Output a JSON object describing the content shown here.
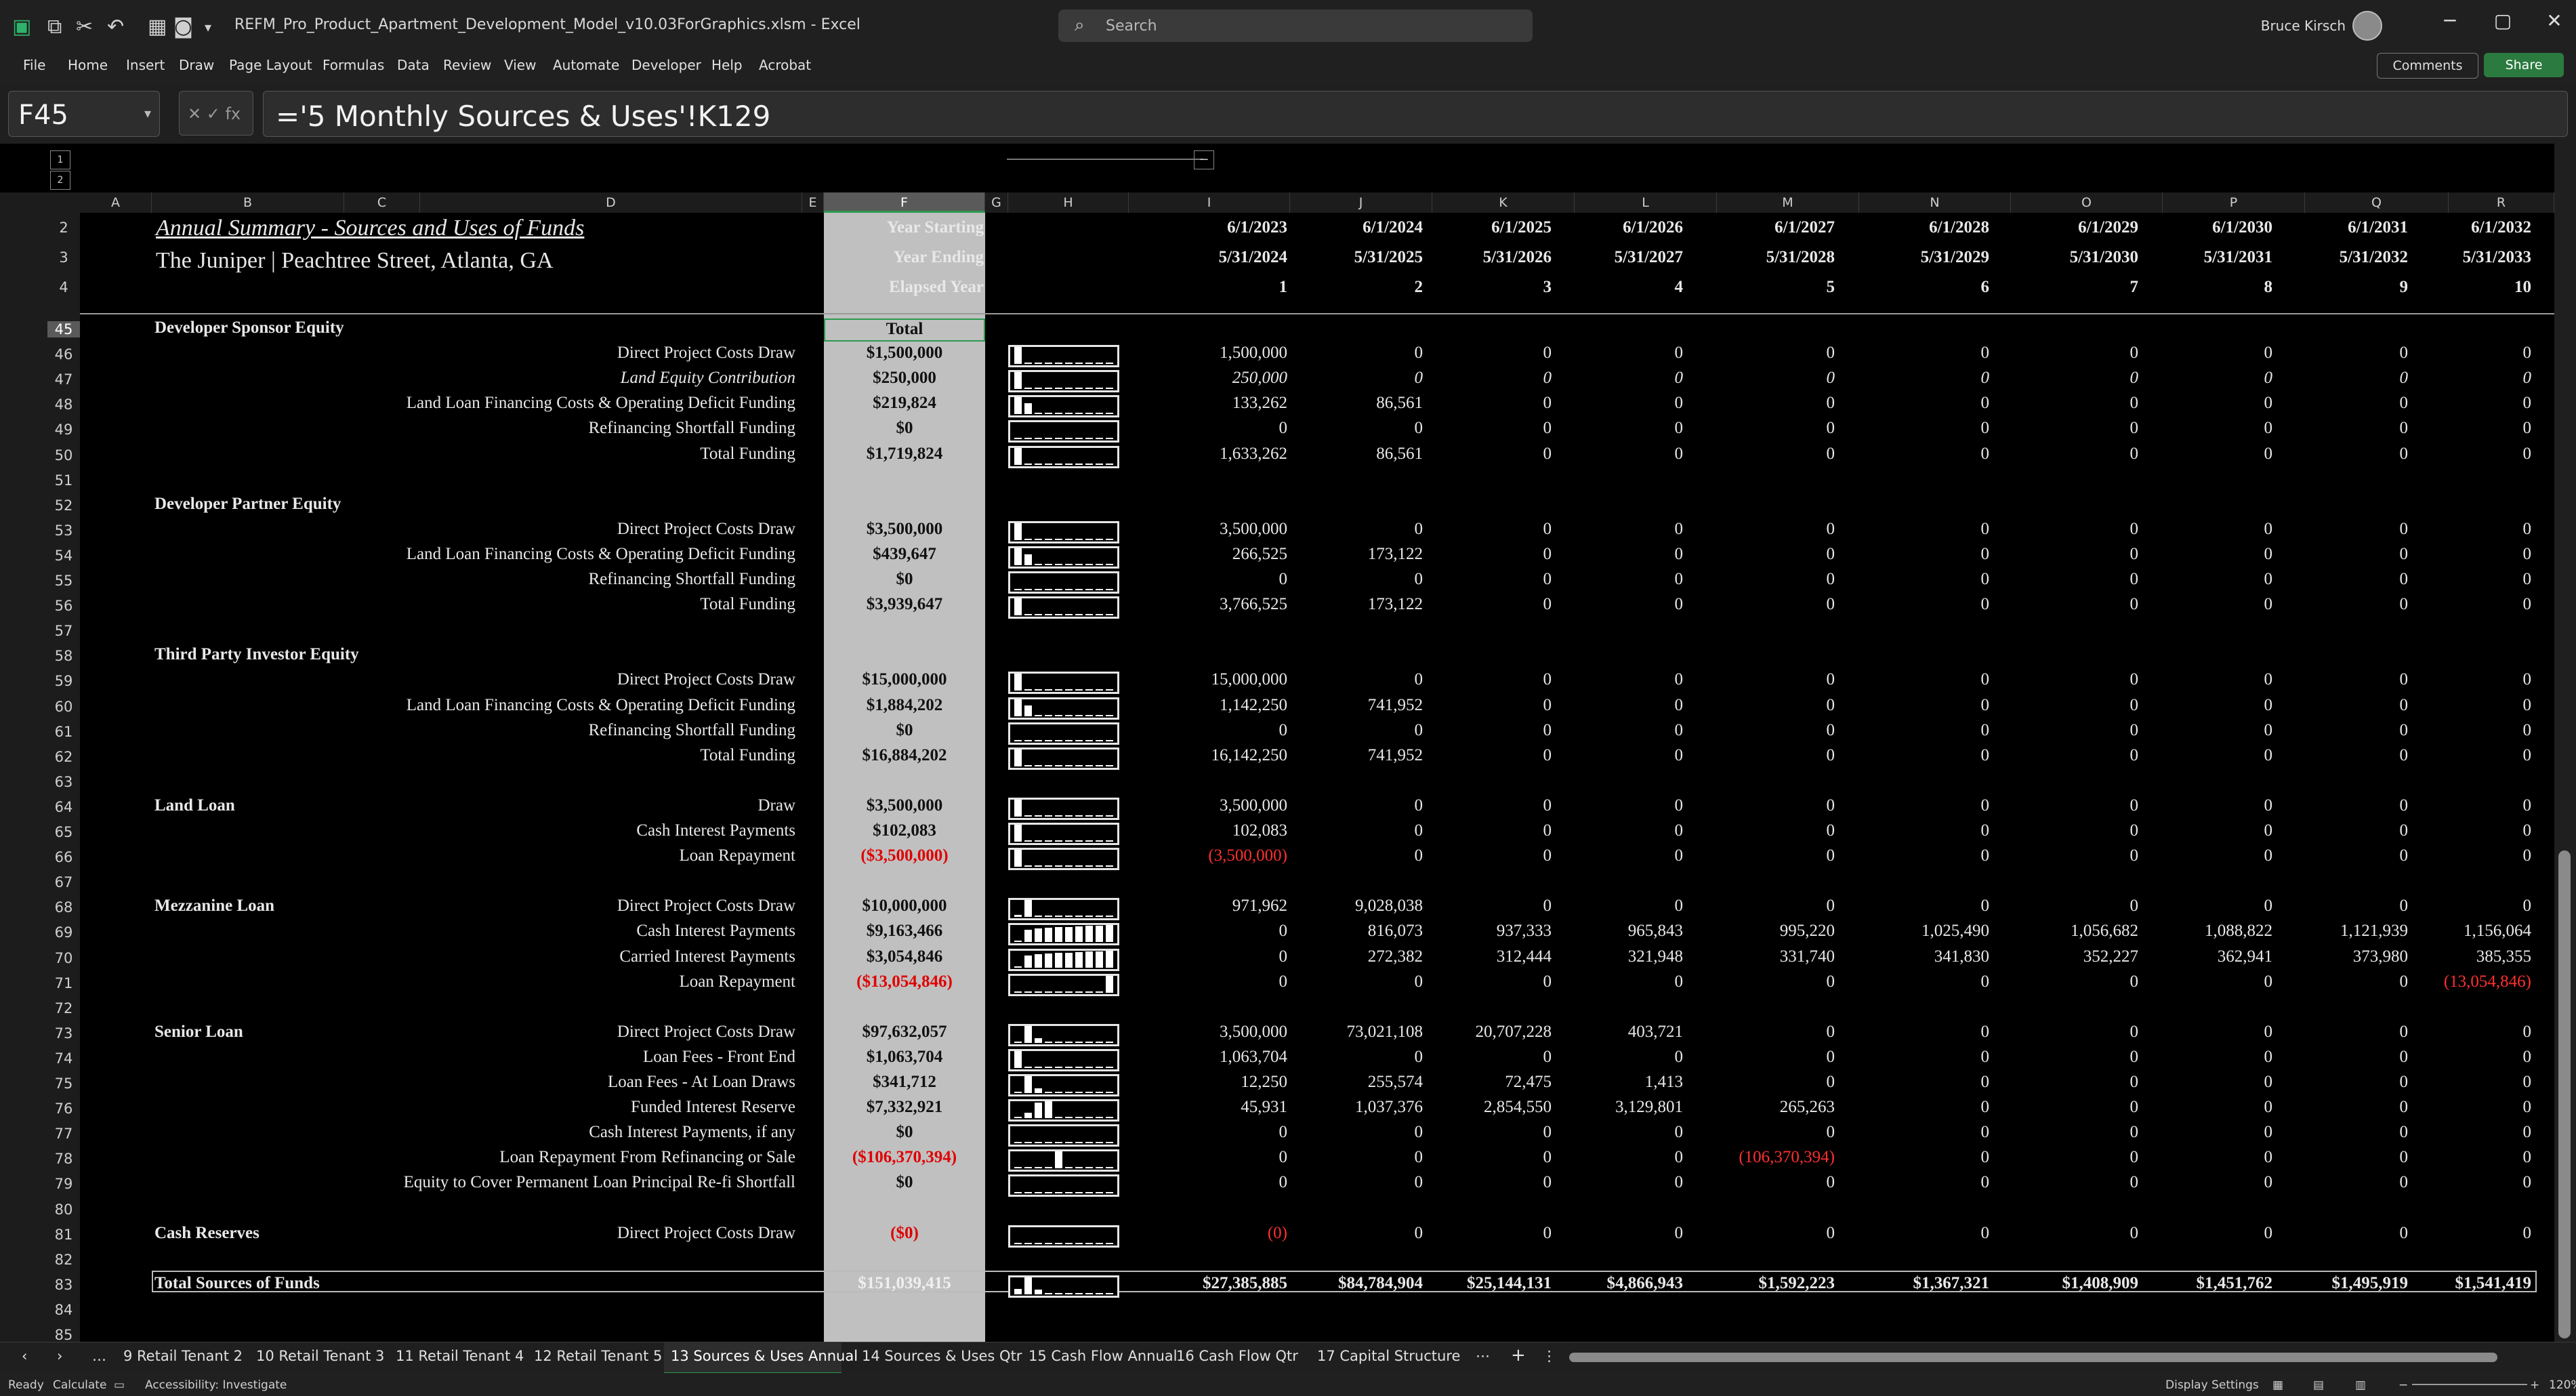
{
  "app": {
    "file_name": "REFM_Pro_Product_Apartment_Development_Model_v10.03ForGraphics.xlsm",
    "app_name": "Excel",
    "title_sep": "-",
    "search_placeholder": "Search",
    "user_name": "Bruce Kirsch",
    "win_minimize": "─",
    "win_restore": "▢",
    "win_close": "✕"
  },
  "menu": [
    "File",
    "Home",
    "Insert",
    "Draw",
    "Page Layout",
    "Formulas",
    "Data",
    "Review",
    "View",
    "Automate",
    "Developer",
    "Help",
    "Acrobat"
  ],
  "menu_buttons": {
    "comments": "Comments",
    "share": "Share"
  },
  "formula_bar": {
    "name_box": "F45",
    "formula": "='5 Monthly Sources & Uses'!K129",
    "fx": "fx"
  },
  "column_letters": [
    "A",
    "B",
    "C",
    "D",
    "E",
    "F",
    "G",
    "H",
    "I",
    "J",
    "K",
    "L",
    "M",
    "N",
    "O",
    "P",
    "Q",
    "R"
  ],
  "header": {
    "title": "Annual Summary - Sources and Uses of Funds",
    "subtitle": "The Juniper | Peachtree Street, Atlanta, GA",
    "labels": [
      "Year Starting",
      "Year Ending",
      "Elapsed Year"
    ],
    "year_starting": [
      "6/1/2023",
      "6/1/2024",
      "6/1/2025",
      "6/1/2026",
      "6/1/2027",
      "6/1/2028",
      "6/1/2029",
      "6/1/2030",
      "6/1/2031",
      "6/1/2032"
    ],
    "year_ending": [
      "5/31/2024",
      "5/31/2025",
      "5/31/2026",
      "5/31/2027",
      "5/31/2028",
      "5/31/2029",
      "5/31/2030",
      "5/31/2031",
      "5/31/2032",
      "5/31/2033"
    ],
    "elapsed": [
      "1",
      "2",
      "3",
      "4",
      "5",
      "6",
      "7",
      "8",
      "9",
      "10"
    ],
    "total_header": "Total"
  },
  "header_row_numbers": [
    "2",
    "3",
    "4"
  ],
  "rows": [
    {
      "n": "45",
      "section": "Developer Sponsor Equity",
      "label": "",
      "total": "",
      "vals": []
    },
    {
      "n": "46",
      "label": "Direct Project Costs Draw",
      "total": "$1,500,000",
      "vals": [
        "1,500,000",
        "0",
        "0",
        "0",
        "0",
        "0",
        "0",
        "0",
        "0",
        "0"
      ]
    },
    {
      "n": "47",
      "label": "Land Equity Contribution",
      "italic": true,
      "total": "$250,000",
      "vals": [
        "250,000",
        "0",
        "0",
        "0",
        "0",
        "0",
        "0",
        "0",
        "0",
        "0"
      ]
    },
    {
      "n": "48",
      "label": "Land Loan Financing Costs & Operating Deficit Funding",
      "total": "$219,824",
      "vals": [
        "133,262",
        "86,561",
        "0",
        "0",
        "0",
        "0",
        "0",
        "0",
        "0",
        "0"
      ]
    },
    {
      "n": "49",
      "label": "Refinancing Shortfall Funding",
      "total": "$0",
      "vals": [
        "0",
        "0",
        "0",
        "0",
        "0",
        "0",
        "0",
        "0",
        "0",
        "0"
      ]
    },
    {
      "n": "50",
      "label": "Total Funding",
      "total": "$1,719,824",
      "vals": [
        "1,633,262",
        "86,561",
        "0",
        "0",
        "0",
        "0",
        "0",
        "0",
        "0",
        "0"
      ]
    },
    {
      "n": "51",
      "label": "",
      "total": "",
      "vals": []
    },
    {
      "n": "52",
      "section": "Developer Partner Equity",
      "label": "",
      "total": "",
      "vals": []
    },
    {
      "n": "53",
      "label": "Direct Project Costs Draw",
      "total": "$3,500,000",
      "vals": [
        "3,500,000",
        "0",
        "0",
        "0",
        "0",
        "0",
        "0",
        "0",
        "0",
        "0"
      ]
    },
    {
      "n": "54",
      "label": "Land Loan Financing Costs & Operating Deficit Funding",
      "total": "$439,647",
      "vals": [
        "266,525",
        "173,122",
        "0",
        "0",
        "0",
        "0",
        "0",
        "0",
        "0",
        "0"
      ]
    },
    {
      "n": "55",
      "label": "Refinancing Shortfall Funding",
      "total": "$0",
      "vals": [
        "0",
        "0",
        "0",
        "0",
        "0",
        "0",
        "0",
        "0",
        "0",
        "0"
      ]
    },
    {
      "n": "56",
      "label": "Total Funding",
      "total": "$3,939,647",
      "vals": [
        "3,766,525",
        "173,122",
        "0",
        "0",
        "0",
        "0",
        "0",
        "0",
        "0",
        "0"
      ]
    },
    {
      "n": "57",
      "label": "",
      "total": "",
      "vals": []
    },
    {
      "n": "58",
      "section": "Third Party Investor Equity",
      "label": "",
      "total": "",
      "vals": []
    },
    {
      "n": "59",
      "label": "Direct Project Costs Draw",
      "total": "$15,000,000",
      "vals": [
        "15,000,000",
        "0",
        "0",
        "0",
        "0",
        "0",
        "0",
        "0",
        "0",
        "0"
      ]
    },
    {
      "n": "60",
      "label": "Land Loan Financing Costs & Operating Deficit Funding",
      "total": "$1,884,202",
      "vals": [
        "1,142,250",
        "741,952",
        "0",
        "0",
        "0",
        "0",
        "0",
        "0",
        "0",
        "0"
      ]
    },
    {
      "n": "61",
      "label": "Refinancing Shortfall Funding",
      "total": "$0",
      "vals": [
        "0",
        "0",
        "0",
        "0",
        "0",
        "0",
        "0",
        "0",
        "0",
        "0"
      ]
    },
    {
      "n": "62",
      "label": "Total Funding",
      "total": "$16,884,202",
      "vals": [
        "16,142,250",
        "741,952",
        "0",
        "0",
        "0",
        "0",
        "0",
        "0",
        "0",
        "0"
      ]
    },
    {
      "n": "63",
      "label": "",
      "total": "",
      "vals": []
    },
    {
      "n": "64",
      "section": "Land Loan",
      "label": "Draw",
      "total": "$3,500,000",
      "vals": [
        "3,500,000",
        "0",
        "0",
        "0",
        "0",
        "0",
        "0",
        "0",
        "0",
        "0"
      ]
    },
    {
      "n": "65",
      "label": "Cash Interest Payments",
      "total": "$102,083",
      "vals": [
        "102,083",
        "0",
        "0",
        "0",
        "0",
        "0",
        "0",
        "0",
        "0",
        "0"
      ]
    },
    {
      "n": "66",
      "label": "Loan Repayment",
      "total": "($3,500,000)",
      "total_red": true,
      "vals": [
        "(3,500,000)",
        "0",
        "0",
        "0",
        "0",
        "0",
        "0",
        "0",
        "0",
        "0"
      ],
      "red_idx": [
        0
      ]
    },
    {
      "n": "67",
      "label": "",
      "total": "",
      "vals": []
    },
    {
      "n": "68",
      "section": "Mezzanine Loan",
      "label": "Direct Project Costs Draw",
      "total": "$10,000,000",
      "vals": [
        "971,962",
        "9,028,038",
        "0",
        "0",
        "0",
        "0",
        "0",
        "0",
        "0",
        "0"
      ]
    },
    {
      "n": "69",
      "label": "Cash Interest Payments",
      "total": "$9,163,466",
      "vals": [
        "0",
        "816,073",
        "937,333",
        "965,843",
        "995,220",
        "1,025,490",
        "1,056,682",
        "1,088,822",
        "1,121,939",
        "1,156,064"
      ]
    },
    {
      "n": "70",
      "label": "Carried Interest Payments",
      "total": "$3,054,846",
      "vals": [
        "0",
        "272,382",
        "312,444",
        "321,948",
        "331,740",
        "341,830",
        "352,227",
        "362,941",
        "373,980",
        "385,355"
      ]
    },
    {
      "n": "71",
      "label": "Loan Repayment",
      "total": "($13,054,846)",
      "total_red": true,
      "vals": [
        "0",
        "0",
        "0",
        "0",
        "0",
        "0",
        "0",
        "0",
        "0",
        "(13,054,846)"
      ],
      "red_idx": [
        9
      ]
    },
    {
      "n": "72",
      "label": "",
      "total": "",
      "vals": []
    },
    {
      "n": "73",
      "section": "Senior Loan",
      "label": "Direct Project Costs Draw",
      "total": "$97,632,057",
      "vals": [
        "3,500,000",
        "73,021,108",
        "20,707,228",
        "403,721",
        "0",
        "0",
        "0",
        "0",
        "0",
        "0"
      ]
    },
    {
      "n": "74",
      "label": "Loan Fees - Front End",
      "total": "$1,063,704",
      "vals": [
        "1,063,704",
        "0",
        "0",
        "0",
        "0",
        "0",
        "0",
        "0",
        "0",
        "0"
      ]
    },
    {
      "n": "75",
      "label": "Loan Fees - At Loan Draws",
      "total": "$341,712",
      "vals": [
        "12,250",
        "255,574",
        "72,475",
        "1,413",
        "0",
        "0",
        "0",
        "0",
        "0",
        "0"
      ]
    },
    {
      "n": "76",
      "label": "Funded Interest Reserve",
      "total": "$7,332,921",
      "vals": [
        "45,931",
        "1,037,376",
        "2,854,550",
        "3,129,801",
        "265,263",
        "0",
        "0",
        "0",
        "0",
        "0"
      ]
    },
    {
      "n": "77",
      "label": "Cash Interest Payments, if any",
      "total": "$0",
      "vals": [
        "0",
        "0",
        "0",
        "0",
        "0",
        "0",
        "0",
        "0",
        "0",
        "0"
      ]
    },
    {
      "n": "78",
      "label": "Loan Repayment From Refinancing or Sale",
      "total": "($106,370,394)",
      "total_red": true,
      "vals": [
        "0",
        "0",
        "0",
        "0",
        "(106,370,394)",
        "0",
        "0",
        "0",
        "0",
        "0"
      ],
      "red_idx": [
        4
      ]
    },
    {
      "n": "79",
      "label": "Equity to Cover Permanent Loan Principal Re-fi Shortfall",
      "total": "$0",
      "vals": [
        "0",
        "0",
        "0",
        "0",
        "0",
        "0",
        "0",
        "0",
        "0",
        "0"
      ]
    },
    {
      "n": "80",
      "label": "",
      "total": "",
      "vals": []
    },
    {
      "n": "81",
      "section": "Cash Reserves",
      "label": "Direct Project Costs Draw",
      "total": "($0)",
      "total_red": true,
      "vals": [
        "(0)",
        "0",
        "0",
        "0",
        "0",
        "0",
        "0",
        "0",
        "0",
        "0"
      ],
      "red_idx": [
        0
      ]
    },
    {
      "n": "82",
      "label": "",
      "total": "",
      "vals": []
    },
    {
      "n": "83",
      "section": "Total Sources of Funds",
      "label": "",
      "total": "$151,039,415",
      "total_white": true,
      "vals": [
        "$27,385,885",
        "$84,784,904",
        "$25,144,131",
        "$4,866,943",
        "$1,592,223",
        "$1,367,321",
        "$1,408,909",
        "$1,451,762",
        "$1,495,919",
        "$1,541,419"
      ],
      "bold_vals": true
    },
    {
      "n": "84",
      "label": "",
      "total": "",
      "vals": []
    },
    {
      "n": "85",
      "label": "",
      "total": "",
      "vals": []
    }
  ],
  "sheet_tabs": [
    "9 Retail Tenant 2",
    "10 Retail Tenant 3",
    "11 Retail Tenant 4",
    "12 Retail Tenant 5",
    "13 Sources & Uses Annual",
    "14 Sources & Uses Qtr",
    "15 Cash Flow Annual",
    "16 Cash Flow Qtr",
    "17 Capital Structure"
  ],
  "active_sheet": "13 Sources & Uses Annual",
  "status": {
    "ready": "Ready",
    "calculate": "Calculate",
    "accessibility": "Accessibility: Investigate",
    "display_settings": "Display Settings",
    "zoom": "120%"
  }
}
